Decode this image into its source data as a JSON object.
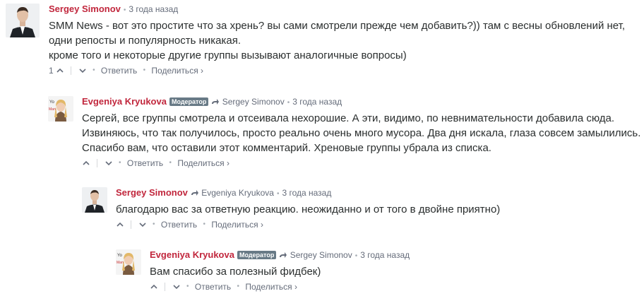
{
  "comments": [
    {
      "author": "Sergey Simonov",
      "time": "3 года назад",
      "text": "SMM News - вот это простите что за хрень? вы сами смотрели прежде чем добавить?)) там с весны обновлений нет,\nодни репосты и популярность никакая.\nкроме того и некоторые другие группы вызывают аналогичные вопросы)",
      "votes": "1",
      "reply_label": "Ответить",
      "share_label": "Поделиться ›"
    },
    {
      "author": "Evgeniya Kryukova",
      "badge": "Модератор",
      "reply_to": "Sergey Simonov",
      "time": "3 года назад",
      "text": "Сергей, все группы смотрела и отсеивала нехорошие. А эти, видимо, по невнимательности добавила сюда.\nИзвиняюсь, что так получилось, просто реально очень много мусора. Два дня искала, глаза совсем замылились.\nСпасибо вам, что оставили этот комментарий. Хреновые группы убрала из списка.",
      "reply_label": "Ответить",
      "share_label": "Поделиться ›"
    },
    {
      "author": "Sergey Simonov",
      "reply_to": "Evgeniya Kryukova",
      "time": "3 года назад",
      "text": "благодарю вас за ответную реакцию. неожиданно и от того в двойне приятно)",
      "reply_label": "Ответить",
      "share_label": "Поделиться ›"
    },
    {
      "author": "Evgeniya Kryukova",
      "badge": "Модератор",
      "reply_to": "Sergey Simonov",
      "time": "3 года назад",
      "text": "Вам спасибо за полезный фидбек)",
      "reply_label": "Ответить",
      "share_label": "Поделиться ›"
    }
  ],
  "colors": {
    "author": "#c1263c",
    "badge_bg": "#687a86",
    "meta": "#656c7a",
    "text": "#2a2e2e"
  },
  "icons": [
    "upvote-icon",
    "downvote-icon",
    "reply-arrow-icon",
    "avatar-man",
    "avatar-woman"
  ]
}
